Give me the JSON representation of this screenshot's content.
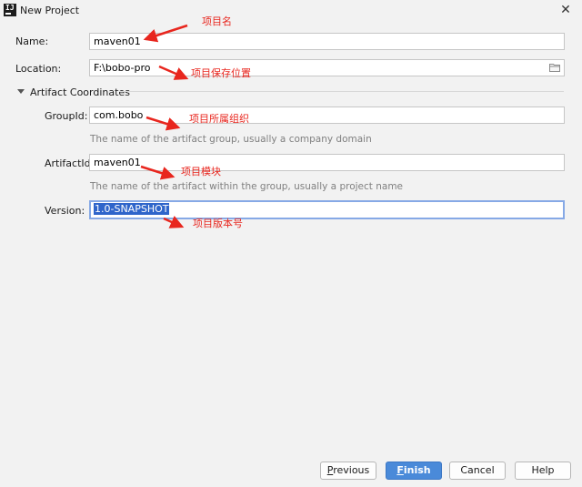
{
  "window": {
    "title": "New Project",
    "app_icon": "IJ"
  },
  "form": {
    "name_label": "Name:",
    "name_value": "maven01",
    "location_label": "Location:",
    "location_value": "F:\\bobo-pro",
    "section_title": "Artifact Coordinates",
    "groupid_label": "GroupId:",
    "groupid_value": "com.bobo",
    "groupid_hint": "The name of the artifact group, usually a company domain",
    "artifactid_label": "ArtifactId:",
    "artifactid_value": "maven01",
    "artifactid_hint": "The name of the artifact within the group, usually a project name",
    "version_label": "Version:",
    "version_value": "1.0-SNAPSHOT"
  },
  "annotations": {
    "name": "项目名",
    "location": "项目保存位置",
    "groupid": "项目所属组织",
    "artifactid": "项目模块",
    "version": "项目版本号"
  },
  "buttons": {
    "previous_mnemonic": "P",
    "previous_rest": "revious",
    "finish_mnemonic": "F",
    "finish_rest": "inish",
    "cancel": "Cancel",
    "help": "Help"
  },
  "colors": {
    "accent": "#4a8ad9",
    "annotation": "#e8261e",
    "selection": "#2f65ca"
  }
}
